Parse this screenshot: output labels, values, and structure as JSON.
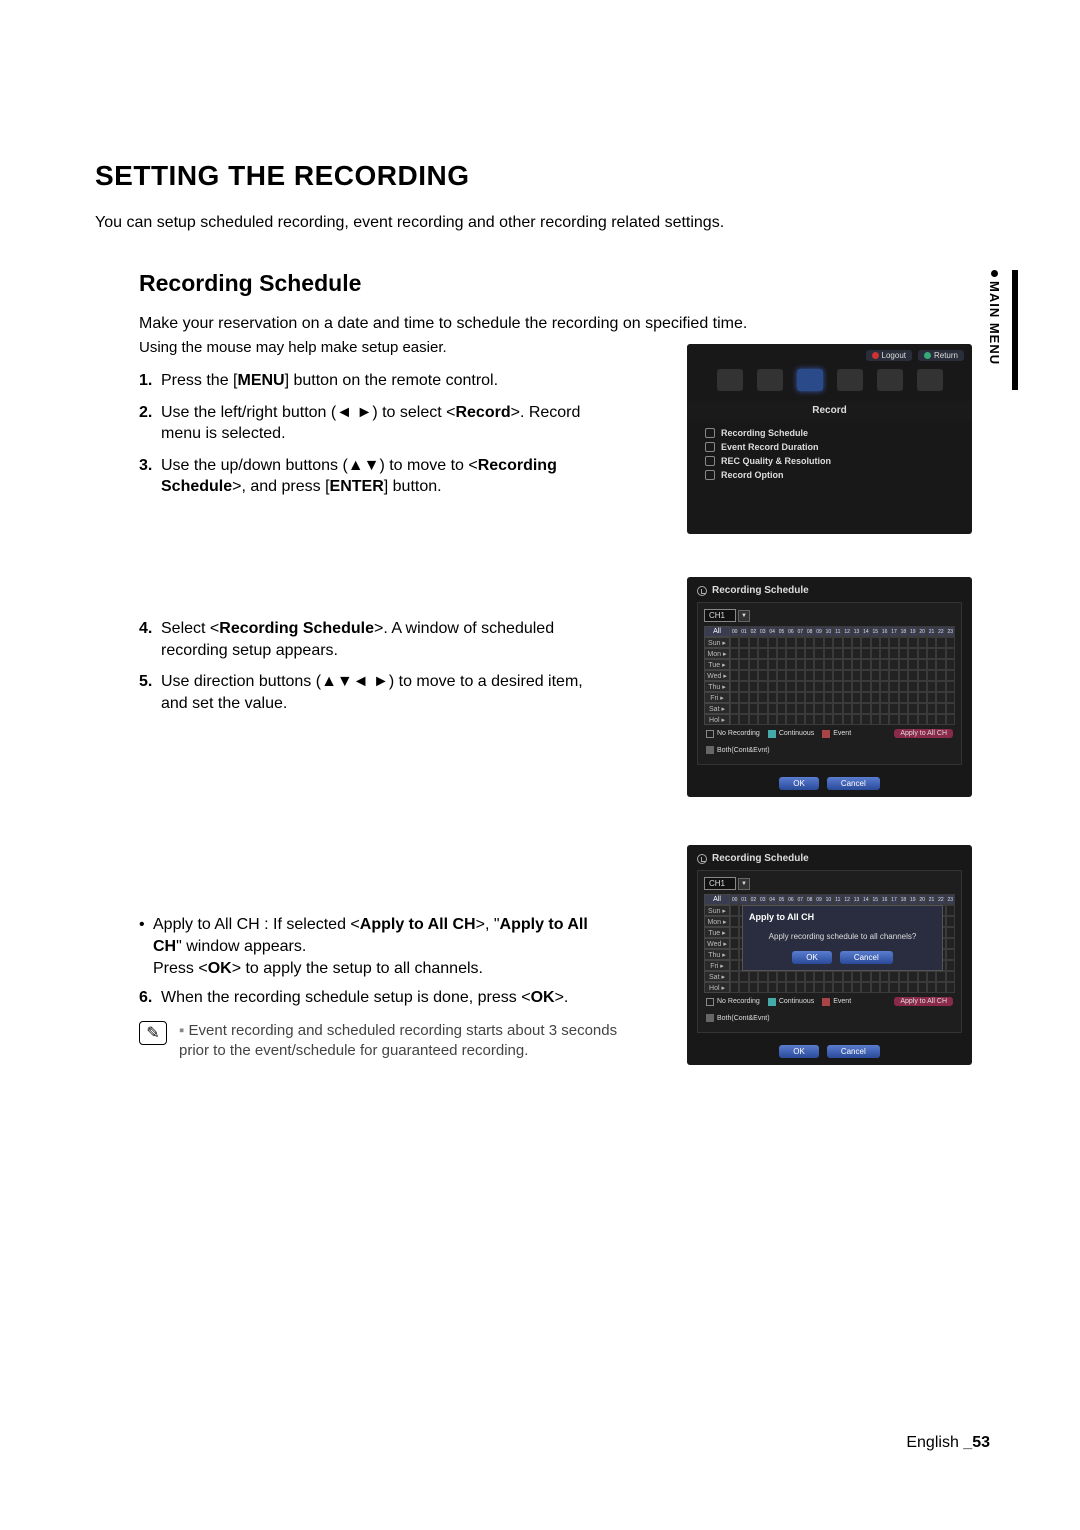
{
  "page": {
    "title": "SETTING THE RECORDING",
    "intro": "You can setup scheduled recording, event recording and other recording related settings.",
    "side_tab": "MAIN MENU",
    "footer_lang": "English",
    "footer_page": "_53"
  },
  "section": {
    "title": "Recording Schedule",
    "desc": "Make your reservation on a date and time to schedule the recording on specified time.",
    "hint": "Using the mouse may help make setup easier."
  },
  "steps_a": [
    {
      "n": "1.",
      "pre": "Press the [",
      "b1": "MENU",
      "post": "] button on the remote control."
    },
    {
      "n": "2.",
      "pre": "Use the left/right button (◄ ►) to select <",
      "b1": "Record",
      "post": ">. Record menu is selected."
    },
    {
      "n": "3.",
      "pre": "Use the up/down buttons (▲▼) to move to <",
      "b1": "Recording Schedule",
      "mid": ">, and press [",
      "b2": "ENTER",
      "post": "] button."
    }
  ],
  "steps_b": [
    {
      "n": "4.",
      "pre": "Select <",
      "b1": "Recording Schedule",
      "post": ">. A window of scheduled recording setup appears."
    },
    {
      "n": "5.",
      "pre": "Use direction buttons (▲▼◄ ►) to move to a desired item, and set the value.",
      "b1": "",
      "post": ""
    }
  ],
  "bullet": {
    "pre": "Apply to All CH : If selected <",
    "b1": "Apply to All CH",
    "mid": ">, \"",
    "b2": "Apply to All CH",
    "post": "\" window appears.",
    "line2a": "Press <",
    "line2b": "OK",
    "line2c": "> to apply the setup to all channels."
  },
  "steps_c": [
    {
      "n": "6.",
      "pre": "When the recording schedule setup is done, press <",
      "b1": "OK",
      "post": ">."
    }
  ],
  "note": "Event recording and scheduled recording starts about 3 seconds prior to the event/schedule for guaranteed recording.",
  "shot1": {
    "logout": "Logout",
    "return": "Return",
    "title": "Record",
    "items": [
      "Recording Schedule",
      "Event Record Duration",
      "REC Quality & Resolution",
      "Record Option"
    ]
  },
  "sched": {
    "title": "Recording Schedule",
    "channel": "CH1",
    "all": "All",
    "days": [
      "Sun",
      "Mon",
      "Tue",
      "Wed",
      "Thu",
      "Fri",
      "Sat",
      "Hol"
    ],
    "hours": [
      "00",
      "01",
      "02",
      "03",
      "04",
      "05",
      "06",
      "07",
      "08",
      "09",
      "10",
      "11",
      "12",
      "13",
      "14",
      "15",
      "16",
      "17",
      "18",
      "19",
      "20",
      "21",
      "22",
      "23"
    ],
    "legend": {
      "no": "No Recording",
      "cont": "Continuous",
      "event": "Event",
      "both": "Both(Cont&Evnt)"
    },
    "apply_btn": "Apply to All CH",
    "ok": "OK",
    "cancel": "Cancel"
  },
  "modal": {
    "title": "Apply to All CH",
    "msg": "Apply recording schedule to all channels?",
    "ok": "OK",
    "cancel": "Cancel"
  }
}
